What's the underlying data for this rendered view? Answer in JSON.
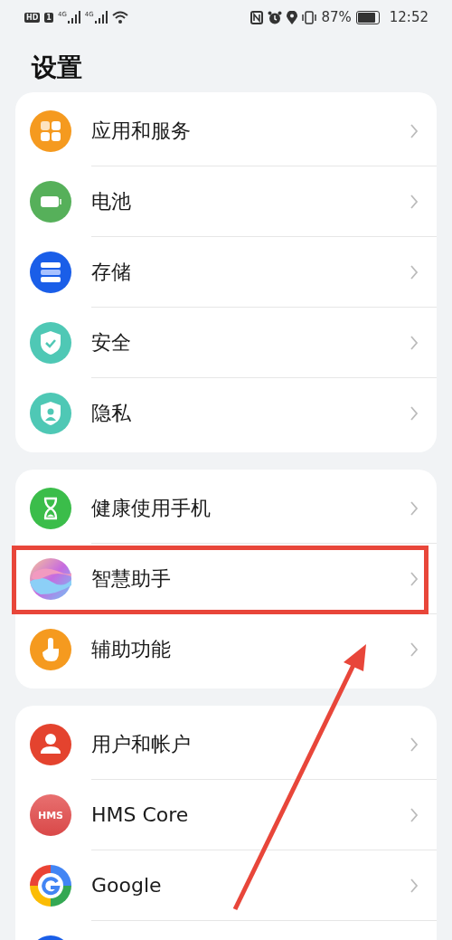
{
  "status_bar": {
    "sim_badge": "HD",
    "sim_slot": "1",
    "networks": [
      "4G",
      "4G"
    ],
    "battery_percent": "87%",
    "time": "12:52"
  },
  "title": "设置",
  "groups": [
    {
      "items": [
        {
          "kind": "apps",
          "label": "应用和服务"
        },
        {
          "kind": "battery",
          "label": "电池"
        },
        {
          "kind": "storage",
          "label": "存储"
        },
        {
          "kind": "security",
          "label": "安全"
        },
        {
          "kind": "privacy",
          "label": "隐私"
        }
      ]
    },
    {
      "items": [
        {
          "kind": "health",
          "label": "健康使用手机"
        },
        {
          "kind": "assistant",
          "label": "智慧助手",
          "highlighted": true
        },
        {
          "kind": "accessibility",
          "label": "辅助功能"
        }
      ]
    },
    {
      "items": [
        {
          "kind": "user",
          "label": "用户和帐户"
        },
        {
          "kind": "hms",
          "label": "HMS Core",
          "icon_text": "HMS"
        },
        {
          "kind": "google",
          "label": "Google"
        },
        {
          "kind": "partial"
        }
      ]
    }
  ],
  "annotation": {
    "kind": "arrow"
  }
}
